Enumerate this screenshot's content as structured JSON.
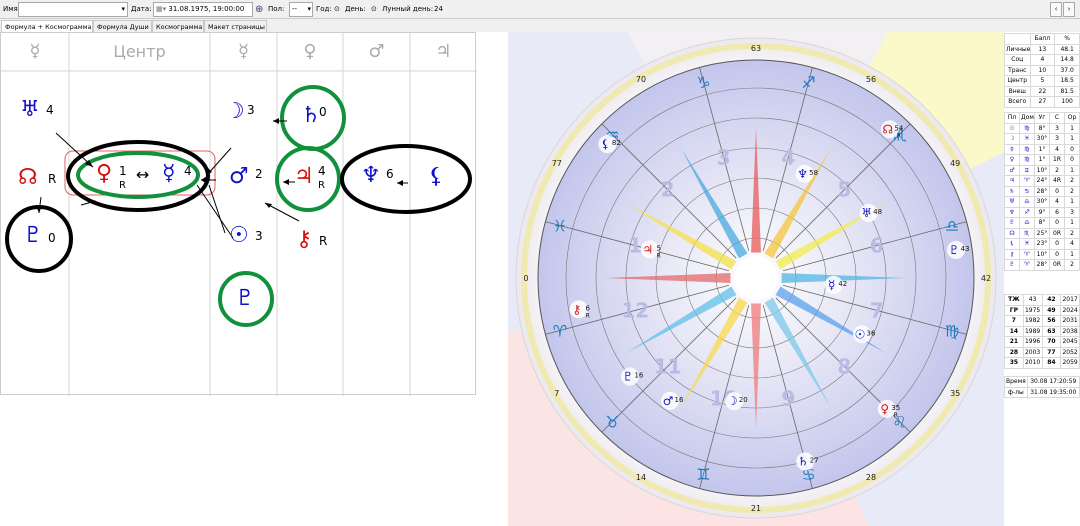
{
  "toolbar": {
    "name_label": "Имя:",
    "name_value": "",
    "date_label": "Дата:",
    "date_value": "31.08.1975, 19:00:00",
    "pol_label": "Пол:",
    "pol_value": "--",
    "year_label": "Год:",
    "day_label": "День:",
    "lunar_label": "Лунный день:",
    "lunar_value": "24",
    "prev": "‹",
    "next": "›"
  },
  "tabs": [
    "Формула + Космограмма",
    "Формула Души",
    "Космограмма",
    "Макет страницы"
  ],
  "formula": {
    "headers": [
      "☿",
      "Центр",
      "☿",
      "♀",
      "♂",
      "♃"
    ],
    "glyphs": {
      "uranus": "♅",
      "node": "☊",
      "pluto": "♇",
      "venus": "♀",
      "mercury": "☿",
      "moon": "☽",
      "mars": "♂",
      "sun": "☉",
      "saturn": "♄",
      "jupiter": "♃",
      "neptune": "♆",
      "lilith": "⚸",
      "chiron": "⚷",
      "proserpina": "♇",
      "dblarrow": "↔"
    },
    "nums": {
      "uranus": "4",
      "node": "R",
      "pluto": "0",
      "venus": "1",
      "venus_r": "R",
      "mercury": "4",
      "moon": "3",
      "mars": "2",
      "sun": "3",
      "saturn": "0",
      "jupiter": "4",
      "jupiter_r": "R",
      "neptune": "6",
      "chiron": "R"
    }
  },
  "chart": {
    "house_numbers": [
      "1",
      "2",
      "3",
      "4",
      "5",
      "6",
      "7",
      "8",
      "9",
      "10",
      "11",
      "12"
    ],
    "degree_labels": [
      "63",
      "56",
      "49",
      "42",
      "35",
      "28",
      "21",
      "14",
      "7",
      "0",
      "77",
      "70"
    ],
    "signs": [
      "♐",
      "♏",
      "♎",
      "♍",
      "♌",
      "♋",
      "♊",
      "♉",
      "♈",
      "♓",
      "♒",
      "♑"
    ],
    "planets": [
      {
        "g": "♆",
        "deg": "58",
        "c": "#1010c8"
      },
      {
        "g": "☊",
        "deg": "54",
        "r": "R",
        "c": "#d41010"
      },
      {
        "g": "♅",
        "deg": "48",
        "c": "#1010c8"
      },
      {
        "g": "♇",
        "deg": "43",
        "c": "#1010c8"
      },
      {
        "g": "☿",
        "deg": "42",
        "c": "#1010c8"
      },
      {
        "g": "☉",
        "deg": "36",
        "c": "#1010c8"
      },
      {
        "g": "♀",
        "deg": "35",
        "r": "R",
        "c": "#d41010"
      },
      {
        "g": "♄",
        "deg": "27",
        "c": "#1010c8"
      },
      {
        "g": "☽",
        "deg": "20",
        "c": "#1010c8"
      },
      {
        "g": "♂",
        "deg": "16",
        "c": "#1010c8"
      },
      {
        "g": "♇",
        "deg": "16",
        "c": "#1010c8"
      },
      {
        "g": "⚷",
        "deg": "6",
        "r": "R",
        "c": "#d41010"
      },
      {
        "g": "♃",
        "deg": "5",
        "r": "R",
        "c": "#d41010"
      },
      {
        "g": "⚸",
        "deg": "82",
        "c": "#1010c8"
      }
    ]
  },
  "score_table": {
    "headers": [
      "",
      "Балл",
      "%"
    ],
    "rows": [
      [
        "Личные",
        "13",
        "48.1"
      ],
      [
        "Соц",
        "4",
        "14.8"
      ],
      [
        "Транс",
        "10",
        "37.0"
      ],
      [
        "Центр",
        "5",
        "18.5"
      ],
      [
        "Внеш",
        "22",
        "81.5"
      ],
      [
        "Всего",
        "27",
        "100"
      ]
    ]
  },
  "planet_table": {
    "headers": [
      "Пл",
      "Дом",
      "Уг",
      "С",
      "Ор"
    ],
    "rows": [
      [
        "☉",
        "♍",
        "8°",
        "3",
        "1"
      ],
      [
        "☽",
        "♓",
        "30°",
        "3",
        "1"
      ],
      [
        "☿",
        "♍",
        "1°",
        "4",
        "0"
      ],
      [
        "♀",
        "♍",
        "1°",
        "1R",
        "0"
      ],
      [
        "♂",
        "♊",
        "10°",
        "2",
        "1"
      ],
      [
        "♃",
        "♈",
        "24°",
        "4R",
        "2"
      ],
      [
        "♄",
        "♋",
        "28°",
        "0",
        "2"
      ],
      [
        "♅",
        "♎",
        "30°",
        "4",
        "1"
      ],
      [
        "♆",
        "♐",
        "9°",
        "6",
        "3"
      ],
      [
        "♇",
        "♎",
        "8°",
        "0",
        "1"
      ],
      [
        "☊",
        "♏",
        "25°",
        "0R",
        "2"
      ],
      [
        "⚸",
        "♓",
        "23°",
        "0",
        "4"
      ],
      [
        "⚷",
        "♈",
        "10°",
        "0",
        "1"
      ],
      [
        "♇",
        "♈",
        "28°",
        "0R",
        "2"
      ]
    ]
  },
  "cycles_table": {
    "rows": [
      [
        "ТЖ",
        "43",
        "42",
        "2017"
      ],
      [
        "ГР",
        "1975",
        "49",
        "2024"
      ],
      [
        "7",
        "1982",
        "56",
        "2031"
      ],
      [
        "14",
        "1989",
        "63",
        "2038"
      ],
      [
        "21",
        "1996",
        "70",
        "2045"
      ],
      [
        "28",
        "2003",
        "77",
        "2052"
      ],
      [
        "35",
        "2010",
        "84",
        "2059"
      ]
    ]
  },
  "time_table": {
    "rows": [
      [
        "Время",
        "30.08 17:20:59"
      ],
      [
        "ф-лы",
        "31.08 19:35:00"
      ]
    ]
  }
}
